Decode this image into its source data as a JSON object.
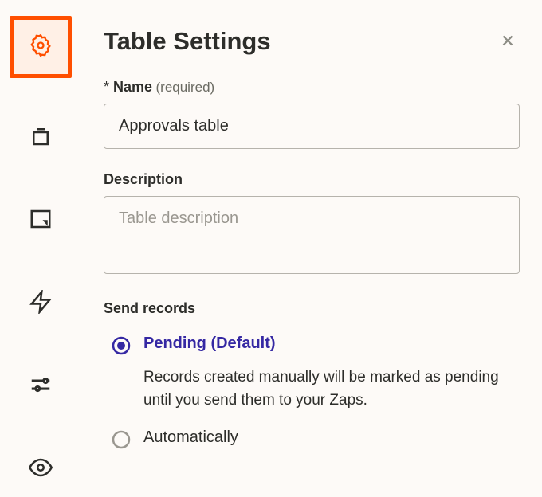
{
  "title": "Table Settings",
  "fields": {
    "name": {
      "label": "Name",
      "hint": "(required)",
      "value": "Approvals table"
    },
    "description": {
      "label": "Description",
      "placeholder": "Table description"
    }
  },
  "sendRecords": {
    "heading": "Send records",
    "options": {
      "pending": {
        "label": "Pending (Default)",
        "description": "Records created manually will be marked as pending until you send them to your Zaps."
      },
      "automatically": {
        "label": "Automatically"
      }
    }
  }
}
